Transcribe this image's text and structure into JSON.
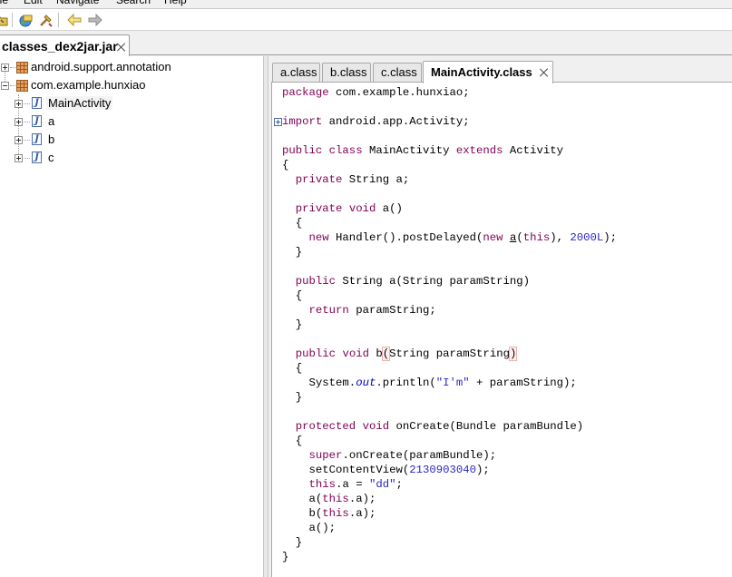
{
  "menubar": {
    "items": [
      "ile",
      "Edit",
      "Navigate",
      "Search",
      "Help"
    ]
  },
  "toolbar": {
    "icons": [
      "open-icon",
      "save-icon",
      "search-icon",
      "tools-icon",
      "back-arrow-icon",
      "forward-arrow-icon"
    ]
  },
  "outer_tab": {
    "label": "classes_dex2jar.jar"
  },
  "tree": {
    "packages": [
      {
        "label": "android.support.annotation"
      },
      {
        "label": "com.example.hunxiao"
      }
    ],
    "classes": [
      {
        "label": "MainActivity"
      },
      {
        "label": "a"
      },
      {
        "label": "b"
      },
      {
        "label": "c"
      }
    ]
  },
  "editor": {
    "tabs": [
      {
        "label": "a.class"
      },
      {
        "label": "b.class"
      },
      {
        "label": "c.class"
      },
      {
        "label": "MainActivity.class"
      }
    ],
    "code": {
      "line_package": "package com.example.hunxiao;",
      "line_import": "import android.app.Activity;",
      "line_class": "public class MainActivity extends Activity",
      "brace_open": "{",
      "field_decl": "private String a;",
      "method_a_decl": "private void a()",
      "method_body_open": "{",
      "handler_call_1": "new Handler().postDelayed(new ",
      "handler_a": "a",
      "handler_call_2": "(this), ",
      "handler_num": "2000L",
      "handler_call_3": ");",
      "method_body_close": "}",
      "method_a_str_decl": "public String a(String paramString)",
      "return_stmt": "return paramString;",
      "method_b_decl_1": "public void b",
      "method_b_paren_open": "(",
      "method_b_decl_2": "String paramString",
      "method_b_paren_close": ")",
      "println_1": "System.",
      "println_out": "out",
      "println_2": ".println(",
      "println_str": "\"I'm\"",
      "println_3": " + paramString);",
      "oncreate_decl": "protected void onCreate(Bundle paramBundle)",
      "super_call": "super.onCreate(paramBundle);",
      "setcontent_1": "setContentView(",
      "setcontent_num": "2130903040",
      "setcontent_2": ");",
      "assign_1": "this.a = ",
      "assign_str": "\"dd\"",
      "assign_2": ";",
      "call_a": "a(this.a);",
      "call_b": "b(this.a);",
      "call_a_empty": "a();",
      "class_close": "}"
    }
  },
  "colors": {
    "keyword": "#7f0055",
    "number": "#2a27c5",
    "field": "#0000c0"
  }
}
